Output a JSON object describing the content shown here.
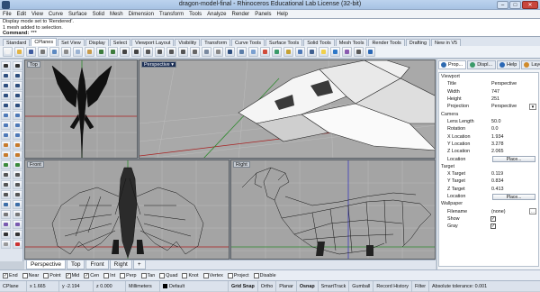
{
  "window": {
    "title": "dragon-model-final - Rhinoceros Educational Lab License (32-bit)"
  },
  "menu": [
    "File",
    "Edit",
    "View",
    "Curve",
    "Surface",
    "Solid",
    "Mesh",
    "Dimension",
    "Transform",
    "Tools",
    "Analyze",
    "Render",
    "Panels",
    "Help"
  ],
  "command_history": [
    "Display mode set to 'Rendered'.",
    "1 mesh added to selection."
  ],
  "command": {
    "prompt": "Command:",
    "value": "***"
  },
  "toolbar_tabs": [
    "Standard",
    "CPlanes",
    "Set View",
    "Display",
    "Select",
    "Viewport Layout",
    "Visibility",
    "Transform",
    "Curve Tools",
    "Surface Tools",
    "Solid Tools",
    "Mesh Tools",
    "Render Tools",
    "Drafting",
    "New in V5"
  ],
  "active_toolbar_tab": "CPlanes",
  "viewports": {
    "top": "Top",
    "perspective": "Perspective",
    "front": "Front",
    "right": "Right"
  },
  "viewport_tabs": [
    "Perspective",
    "Top",
    "Front",
    "Right"
  ],
  "viewport_tab_add": "+",
  "panel": {
    "tabs": [
      "Prop...",
      "Displ...",
      "Help",
      "Layers"
    ],
    "viewport_section": "Viewport",
    "title_key": "Title",
    "title_val": "Perspective",
    "width_key": "Width",
    "width_val": "747",
    "height_key": "Height",
    "height_val": "251",
    "projection_key": "Projection",
    "projection_val": "Perspective",
    "camera_section": "Camera",
    "lens_key": "Lens Length",
    "lens_val": "50.0",
    "rotation_key": "Rotation",
    "rotation_val": "0.0",
    "xloc_key": "X Location",
    "xloc_val": "1.934",
    "yloc_key": "Y Location",
    "yloc_val": "3.278",
    "zloc_key": "Z Location",
    "zloc_val": "2.065",
    "location_key": "Location",
    "place_label": "Place...",
    "target_section": "Target",
    "xt_key": "X Target",
    "xt_val": "0.119",
    "yt_key": "Y Target",
    "yt_val": "0.834",
    "zt_key": "Z Target",
    "zt_val": "0.413",
    "wallpaper_section": "Wallpaper",
    "filename_key": "Filename",
    "filename_val": "(none)",
    "show_key": "Show",
    "gray_key": "Gray"
  },
  "osnaps": [
    {
      "label": "End",
      "checked": true
    },
    {
      "label": "Near",
      "checked": false
    },
    {
      "label": "Point",
      "checked": false
    },
    {
      "label": "Mid",
      "checked": true
    },
    {
      "label": "Cen",
      "checked": true
    },
    {
      "label": "Int",
      "checked": false
    },
    {
      "label": "Perp",
      "checked": false
    },
    {
      "label": "Tan",
      "checked": false
    },
    {
      "label": "Quad",
      "checked": false
    },
    {
      "label": "Knot",
      "checked": false
    },
    {
      "label": "Vertex",
      "checked": false
    },
    {
      "label": "Project",
      "checked": false
    },
    {
      "label": "Disable",
      "checked": false
    }
  ],
  "status": {
    "cplane": "CPlane",
    "x": "x 1.665",
    "y": "y -2.194",
    "z": "z 0.000",
    "units": "Millimeters",
    "layer": "Default",
    "grid_snap": "Grid Snap",
    "ortho": "Ortho",
    "planar": "Planar",
    "osnap": "Osnap",
    "smarttrack": "SmartTrack",
    "gumball": "Gumball",
    "record_history": "Record History",
    "filter": "Filter",
    "tolerance": "Absolute tolerance: 0.001"
  }
}
